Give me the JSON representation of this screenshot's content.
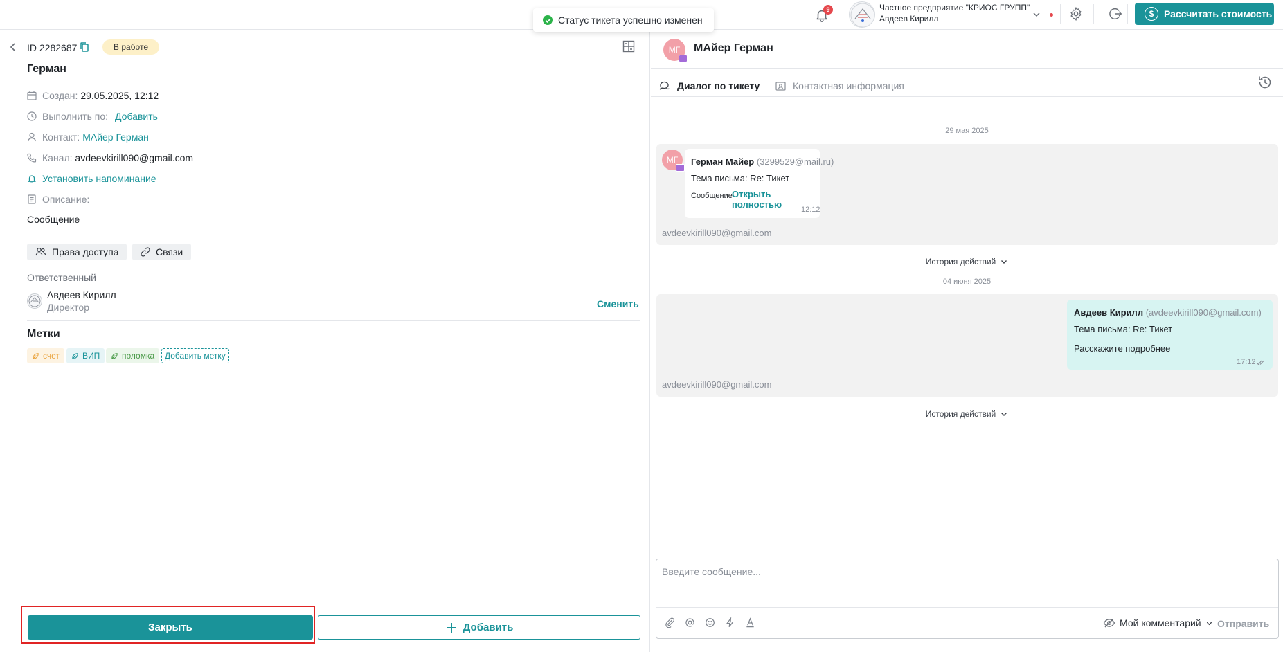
{
  "toast": {
    "text": "Статус тикета успешно изменен"
  },
  "topbar": {
    "notifications_count": "9",
    "company_name": "Частное предприятие \"КРИОС ГРУПП\"",
    "user_name": "Авдеев Кирилл",
    "calc_button": "Рассчитать стоимость",
    "accent_color": "#1a9399"
  },
  "ticket": {
    "id": "ID 2282687",
    "status": "В работе",
    "name": "Герман",
    "created_label": "Создан:",
    "created_value": "29.05.2025, 12:12",
    "due_label": "Выполнить по:",
    "due_link": "Добавить",
    "contact_label": "Контакт:",
    "contact_link": "МАйер Герман",
    "channel_label": "Канал:",
    "channel_value": "avdeevkirill090@gmail.com",
    "reminder_link": "Установить напоминание",
    "description_label": "Описание:",
    "description_value": "Сообщение",
    "access_button": "Права доступа",
    "links_button": "Связи",
    "responsible_label": "Ответственный",
    "responsible_name": "Авдеев Кирилл",
    "responsible_role": "Директор",
    "change_link": "Сменить",
    "tags_title": "Метки",
    "tags": [
      "счет",
      "ВИП",
      "поломка"
    ],
    "add_tag": "Добавить метку",
    "close_button": "Закрыть",
    "add_button": "Добавить"
  },
  "dialog": {
    "contact_initials": "МГ",
    "contact_name": "МАйер Герман",
    "tab_dialog": "Диалог по тикету",
    "tab_contact": "Контактная информация",
    "date1": "29 мая 2025",
    "msg1": {
      "author": "Герман Майер",
      "email": "(3299529@mail.ru)",
      "subject": "Тема письма: Re: Тикет",
      "body_label": "Сообщение",
      "open_link": "Открыть полностью",
      "time": "12:12",
      "channel": "avdeevkirill090@gmail.com"
    },
    "history_label": "История действий",
    "date2": "04 июня 2025",
    "msg2": {
      "author": "Авдеев Кирилл",
      "email": "(avdeevkirill090@gmail.com)",
      "subject": "Тема письма: Re: Тикет",
      "body": "Расскажите подробнее",
      "time": "17:12",
      "channel": "avdeevkirill090@gmail.com"
    },
    "composer_placeholder": "Введите сообщение...",
    "my_comment": "Мой комментарий",
    "send": "Отправить"
  }
}
